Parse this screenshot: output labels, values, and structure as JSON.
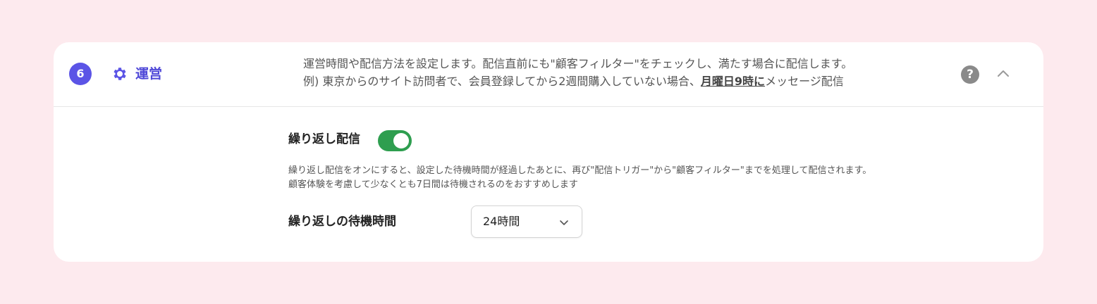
{
  "section": {
    "step_number": "6",
    "title": "運営",
    "description_line1": "運営時間や配信方法を設定します。配信直前にも\"顧客フィルター\"をチェックし、満たす場合に配信します。",
    "description_line2_prefix": "例) 東京からのサイト訪問者で、会員登録してから2週間購入していない場合、",
    "description_line2_highlight": "月曜日9時に",
    "description_line2_suffix": "メッセージ配信",
    "help_symbol": "?"
  },
  "repeat": {
    "label": "繰り返し配信",
    "enabled": true,
    "hint_line1": "繰り返し配信をオンにすると、設定した待機時間が経過したあとに、再び\"配信トリガー\"から\"顧客フィルター\"までを処理して配信されます。",
    "hint_line2": "顧客体験を考慮して少なくとも7日間は待機されるのをおすすめします"
  },
  "wait": {
    "label": "繰り返しの待機時間",
    "selected": "24時間"
  },
  "colors": {
    "background": "#fdeaee",
    "accent": "#5b54e6",
    "toggle_on": "#2e9e4f"
  },
  "icons": {
    "settings": "gear-icon",
    "help": "help-icon",
    "collapse": "chevron-up-icon",
    "dropdown": "chevron-down-icon"
  }
}
